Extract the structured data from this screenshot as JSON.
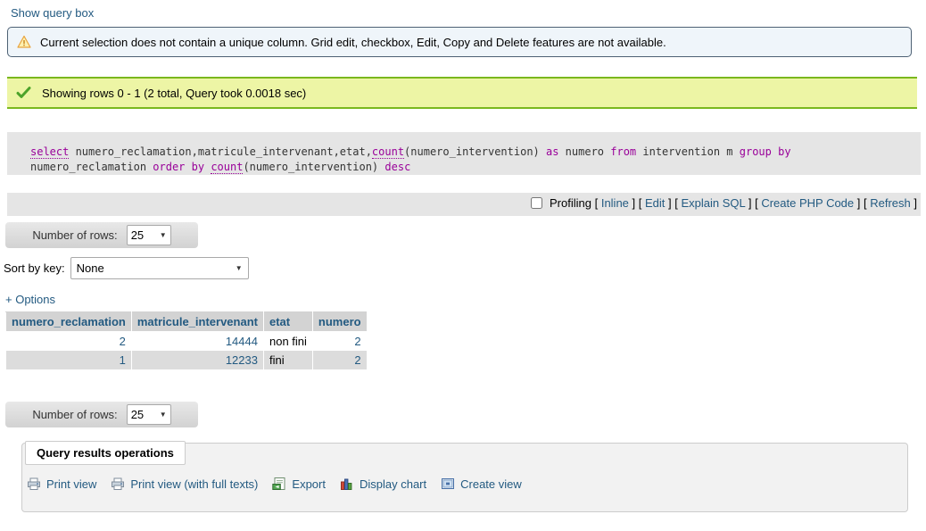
{
  "top": {
    "show_query_box": "Show query box"
  },
  "notice": {
    "icon": "warning-triangle-icon",
    "text": "Current selection does not contain a unique column. Grid edit, checkbox, Edit, Copy and Delete features are not available."
  },
  "success": {
    "icon": "green-check-icon",
    "text": "Showing rows 0 - 1 (2 total, Query took 0.0018 sec)"
  },
  "sql": {
    "tokens": [
      {
        "t": "select",
        "k": "kw-dot"
      },
      {
        "t": " numero_reclamation,matricule_intervenant,etat,",
        "k": "plain"
      },
      {
        "t": "count",
        "k": "kw-dot"
      },
      {
        "t": "(numero_intervention) ",
        "k": "plain"
      },
      {
        "t": "as",
        "k": "kw"
      },
      {
        "t": " numero ",
        "k": "plain"
      },
      {
        "t": "from",
        "k": "kw"
      },
      {
        "t": " intervention m ",
        "k": "plain"
      },
      {
        "t": "group by",
        "k": "kw"
      },
      {
        "t": " numero_reclamation ",
        "k": "plain"
      },
      {
        "t": "order by",
        "k": "kw"
      },
      {
        "t": " ",
        "k": "plain"
      },
      {
        "t": "count",
        "k": "kw-dot"
      },
      {
        "t": "(numero_intervention) ",
        "k": "plain"
      },
      {
        "t": "desc",
        "k": "kw"
      }
    ],
    "full_text": "select numero_reclamation,matricule_intervenant,etat,count(numero_intervention) as numero from intervention m group by numero_reclamation order by count(numero_intervention) desc",
    "actions": {
      "profiling_label": "Profiling",
      "profiling_checked": false,
      "links": [
        "Inline",
        "Edit",
        "Explain SQL",
        "Create PHP Code",
        "Refresh"
      ]
    }
  },
  "controls": {
    "number_of_rows_label": "Number of rows:",
    "number_of_rows_value": "25",
    "sort_by_key_label": "Sort by key:",
    "sort_by_key_value": "None",
    "options_link": "+ Options"
  },
  "table": {
    "columns": [
      "numero_reclamation",
      "matricule_intervenant",
      "etat",
      "numero"
    ],
    "rows": [
      {
        "numero_reclamation": "2",
        "matricule_intervenant": "14444",
        "etat": "non fini",
        "numero": "2"
      },
      {
        "numero_reclamation": "1",
        "matricule_intervenant": "12233",
        "etat": "fini",
        "numero": "2"
      }
    ]
  },
  "query_results_operations": {
    "legend": "Query results operations",
    "items": [
      {
        "label": "Print view",
        "icon": "printer-icon"
      },
      {
        "label": "Print view (with full texts)",
        "icon": "printer-icon"
      },
      {
        "label": "Export",
        "icon": "export-icon"
      },
      {
        "label": "Display chart",
        "icon": "bar-chart-icon"
      },
      {
        "label": "Create view",
        "icon": "create-view-icon"
      }
    ]
  },
  "colors": {
    "link": "#235a81",
    "notice_bg": "#eff5fa",
    "notice_border": "#4d6174",
    "success_bg": "#edf5a5",
    "success_border": "#7ab81e",
    "sql_bg": "#e5e5e5",
    "table_header_bg": "#d3d3d3",
    "row_even_bg": "#dcdcdc",
    "keyword": "#990099"
  }
}
